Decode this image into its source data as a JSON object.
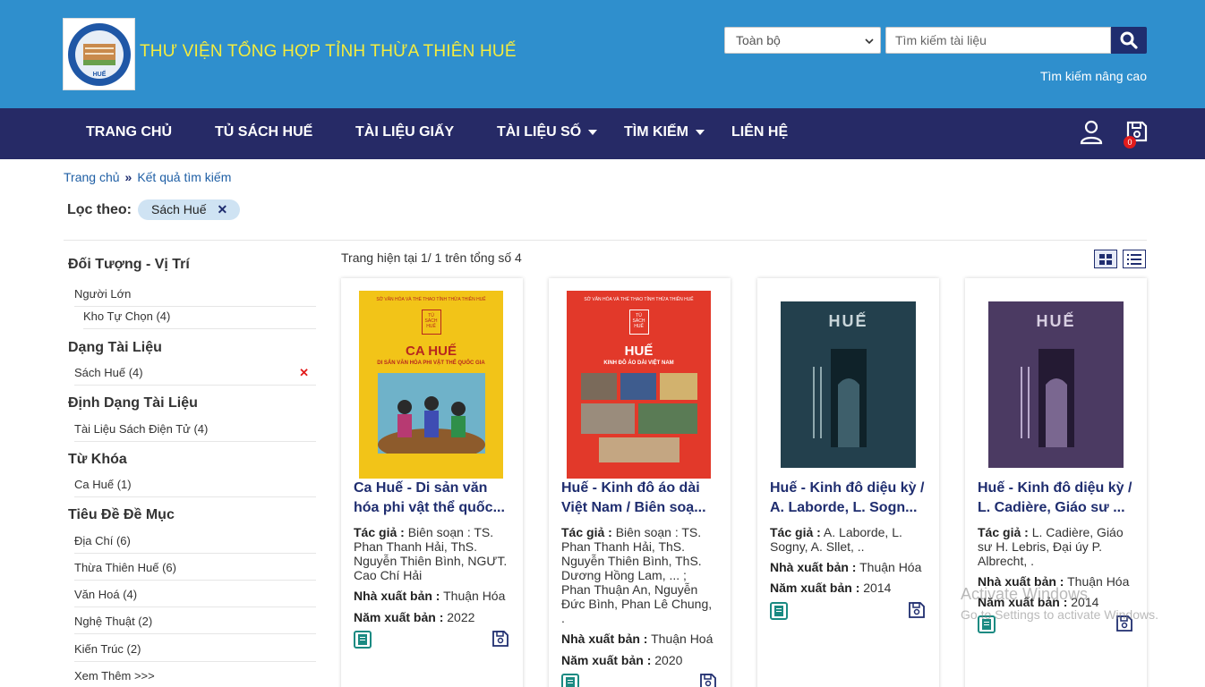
{
  "header": {
    "site_title": "THƯ VIỆN TỔNG HỢP TỈNH THỪA THIÊN HUẾ",
    "logo_text": "HUẾ",
    "scope_select": "Toàn bộ",
    "search_placeholder": "Tìm kiếm tài liệu",
    "advanced_search": "Tìm kiếm nâng cao",
    "bg_color": "#2f8fcd",
    "title_color": "#f5ec3d"
  },
  "nav": {
    "bg_color": "#262a66",
    "items": [
      "TRANG CHỦ",
      "TỦ SÁCH HUẾ",
      "TÀI LIỆU GIẤY",
      "TÀI LIỆU SỐ",
      "TÌM KIẾM",
      "LIÊN HỆ"
    ],
    "cart_count": "0"
  },
  "breadcrumb": {
    "home": "Trang chủ",
    "separator": "»",
    "current": "Kết quả tìm kiếm"
  },
  "filter": {
    "label": "Lọc theo:",
    "chip": "Sách Huế",
    "chip_remove": "✕"
  },
  "sidebar": {
    "groups": [
      {
        "title": "Đối Tượng - Vị Trí",
        "items": [
          "Người Lớn",
          "Kho Tự Chọn (4)"
        ]
      },
      {
        "title": "Dạng Tài Liệu",
        "items": [
          "Sách Huế (4)"
        ],
        "remove": "✕"
      },
      {
        "title": "Định Dạng Tài Liệu",
        "items": [
          "Tài Liệu Sách Điện Tử (4)"
        ]
      },
      {
        "title": "Từ Khóa",
        "items": [
          "Ca Huế (1)"
        ]
      },
      {
        "title": "Tiêu Đề Đề Mục",
        "items": [
          "Địa Chí (6)",
          "Thừa Thiên Huế (6)",
          "Văn Hoá (4)",
          "Nghệ Thuật (2)",
          "Kiến Trúc (2)"
        ]
      }
    ],
    "more": "Xem Thêm >>>"
  },
  "results": {
    "page_info": "Trang hiện tại 1/ 1 trên tổng số 4",
    "author_label": "Tác giả :",
    "publisher_label": "Nhà xuất bản :",
    "year_label": "Năm xuất bản :",
    "cards": [
      {
        "title_line1": "Ca Huế - Di sản văn",
        "title_line2": "hóa phi vật thể quốc...",
        "authors": [
          "Biên soạn : TS.",
          "Phan Thanh Hải, ThS.",
          "Nguyễn Thiên Bình, NGƯT.",
          "Cao Chí Hải"
        ],
        "publisher": "Thuận Hóa",
        "year": "2022",
        "cover": {
          "pub": "SỞ VĂN HÓA VÀ THỂ THAO TỈNH THỪA THIÊN HUẾ",
          "seal": "TỦ SÁCH HUẾ",
          "title": "CA HUẾ",
          "sub": "DI SẢN VĂN HÓA PHI VẬT THỂ QUỐC GIA",
          "bg": "#f2c418",
          "fg": "#b7271f"
        }
      },
      {
        "title_line1": "Huế - Kinh đô áo dài",
        "title_line2": "Việt Nam / Biên soạ...",
        "authors": [
          "Biên soạn : TS.",
          "Phan Thanh Hải, ThS.",
          "Nguyễn Thiên Bình, ThS.",
          "Dương Hồng Lam, ... ;",
          "Phan Thuận An, Nguyễn",
          "Đức Bình, Phan Lê Chung,",
          "."
        ],
        "publisher": "Thuận Hoá",
        "year": "2020",
        "cover": {
          "pub": "SỞ VĂN HÓA VÀ THỂ THAO TỈNH THỪA THIÊN HUẾ",
          "seal": "TỦ SÁCH HUẾ",
          "title": "HUẾ",
          "sub": "KINH ĐÔ ÁO DÀI VIỆT NAM",
          "bg": "#e2392a",
          "fg": "#ffffff"
        }
      },
      {
        "title_line1": "Huế - Kinh đô diệu kỳ /",
        "title_line2": "A. Laborde, L. Sogn...",
        "authors": [
          "A. Laborde, L.",
          "Sogny, A. Sllet, .."
        ],
        "publisher": "Thuận Hóa",
        "year": "2014",
        "cover": {
          "title": "HUẾ",
          "bg": "#23404d",
          "fg": "#c9d6da"
        }
      },
      {
        "title_line1": "Huế - Kinh đô diệu kỳ /",
        "title_line2": "L. Cadière, Giáo sư ...",
        "authors": [
          "L. Cadière, Giáo",
          "sư H. Lebris, Đại úy P.",
          "Albrecht, ."
        ],
        "publisher": "Thuận Hóa",
        "year": "2014",
        "cover": {
          "title": "HUẾ",
          "bg": "#4b3a62",
          "fg": "#d8cfe2"
        }
      }
    ]
  },
  "watermark": {
    "line1": "Activate Windows",
    "line2": "Go to Settings to activate Windows."
  }
}
